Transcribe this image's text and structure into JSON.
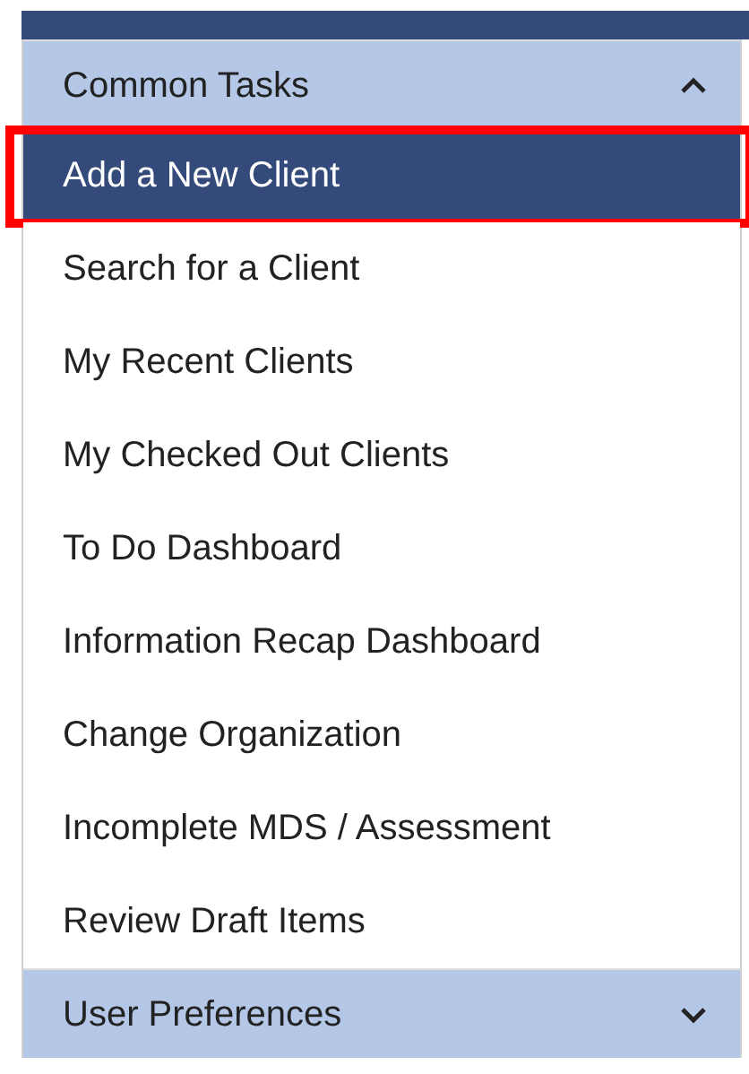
{
  "sections": [
    {
      "title": "Common Tasks",
      "expanded": true,
      "items": [
        {
          "label": "Add a New Client",
          "selected": true,
          "annotated": true
        },
        {
          "label": "Search for a Client",
          "selected": false,
          "annotated": false
        },
        {
          "label": "My Recent Clients",
          "selected": false,
          "annotated": false
        },
        {
          "label": "My Checked Out Clients",
          "selected": false,
          "annotated": false
        },
        {
          "label": "To Do Dashboard",
          "selected": false,
          "annotated": false
        },
        {
          "label": "Information Recap Dashboard",
          "selected": false,
          "annotated": false
        },
        {
          "label": "Change Organization",
          "selected": false,
          "annotated": false
        },
        {
          "label": "Incomplete MDS / Assessment",
          "selected": false,
          "annotated": false
        },
        {
          "label": "Review Draft Items",
          "selected": false,
          "annotated": false
        }
      ]
    },
    {
      "title": "User Preferences",
      "expanded": false
    }
  ]
}
